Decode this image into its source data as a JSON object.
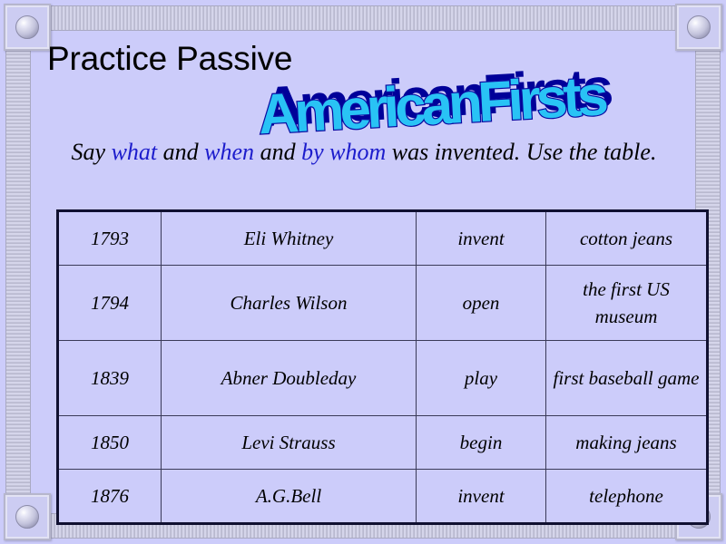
{
  "slide": {
    "background_color": "#ccccfa",
    "title": "Practice Passive",
    "wordart": {
      "text": "AmericanFirsts",
      "fill_color": "#29c3f5",
      "shadow_color": "#000099"
    },
    "subtitle": {
      "highlight_color": "#1c1ccc",
      "parts": [
        {
          "text": "Say ",
          "highlight": false
        },
        {
          "text": "what",
          "highlight": true
        },
        {
          "text": " and ",
          "highlight": false
        },
        {
          "text": "when",
          "highlight": true
        },
        {
          "text": "  and ",
          "highlight": false
        },
        {
          "text": "by whom",
          "highlight": true
        },
        {
          "text": " was invented. Use the table.",
          "highlight": false
        }
      ],
      "plain_text": "Say what and when  and by whom was invented. Use the table."
    }
  },
  "table": {
    "rows": [
      {
        "year": "1793",
        "person": "Eli Whitney",
        "verb": "invent",
        "object": "cotton jeans"
      },
      {
        "year": "1794",
        "person": "Charles Wilson",
        "verb": "open",
        "object": "the first US museum"
      },
      {
        "year": "1839",
        "person": "Abner Doubleday",
        "verb": "play",
        "object": "first baseball game"
      },
      {
        "year": "1850",
        "person": "Levi Strauss",
        "verb": "begin",
        "object": "making jeans"
      },
      {
        "year": "1876",
        "person": "A.G.Bell",
        "verb": "invent",
        "object": "telephone"
      }
    ]
  },
  "frame": {
    "corners": [
      {
        "name": "top-left"
      },
      {
        "name": "top-right"
      },
      {
        "name": "bottom-left"
      },
      {
        "name": "bottom-right"
      }
    ]
  }
}
